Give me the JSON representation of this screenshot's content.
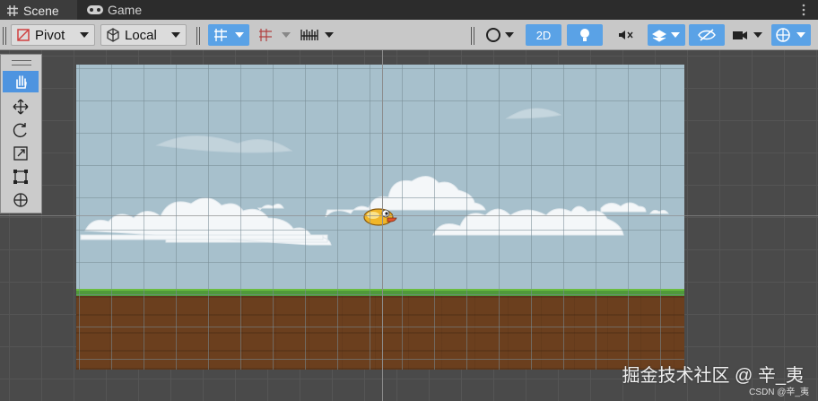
{
  "tabs": [
    {
      "label": "Scene",
      "icon": "hash-icon"
    },
    {
      "label": "Game",
      "icon": "gamepad-icon"
    }
  ],
  "toolbar": {
    "pivot_label": "Pivot",
    "local_label": "Local",
    "mode_2d_label": "2D"
  },
  "tools": [
    "hand-tool",
    "move-tool",
    "rotate-tool",
    "scale-tool",
    "rect-tool",
    "transform-tool"
  ],
  "watermark": "掘金技术社区 @ 辛_夷",
  "credit": "CSDN @辛_夷",
  "colors": {
    "accent": "#5aa2e6",
    "sky": "#a7c0cc",
    "ground": "#6b3f1e",
    "grass": "#4f9a3a"
  }
}
